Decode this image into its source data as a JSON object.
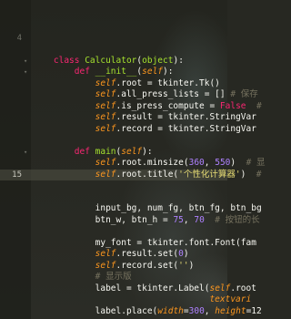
{
  "editor": {
    "lines": [
      {
        "num": "",
        "fold": false,
        "current": false,
        "parts": []
      },
      {
        "num": "",
        "fold": false,
        "current": false,
        "parts": []
      },
      {
        "num": "",
        "fold": false,
        "current": false,
        "parts": []
      },
      {
        "num": "4",
        "fold": false,
        "current": false,
        "parts": []
      },
      {
        "num": "",
        "fold": false,
        "current": false,
        "parts": []
      },
      {
        "num": "",
        "fold": true,
        "current": false,
        "parts": [
          [
            "kw",
            "    class "
          ],
          [
            "cls",
            "Calculator"
          ],
          [
            "name",
            "("
          ],
          [
            "cls",
            "object"
          ],
          [
            "name",
            "):"
          ]
        ]
      },
      {
        "num": "",
        "fold": true,
        "current": false,
        "parts": [
          [
            "kw",
            "        def "
          ],
          [
            "fn",
            "__init__"
          ],
          [
            "name",
            "("
          ],
          [
            "param",
            "self"
          ],
          [
            "name",
            "):"
          ]
        ]
      },
      {
        "num": "",
        "fold": false,
        "current": false,
        "parts": [
          [
            "self",
            "            self"
          ],
          [
            "name",
            ".root = tkinter.Tk()"
          ]
        ]
      },
      {
        "num": "",
        "fold": false,
        "current": false,
        "parts": [
          [
            "self",
            "            self"
          ],
          [
            "name",
            ".all_press_lists = [] "
          ],
          [
            "cm",
            "# 保存"
          ]
        ]
      },
      {
        "num": "",
        "fold": false,
        "current": false,
        "parts": [
          [
            "self",
            "            self"
          ],
          [
            "name",
            ".is_press_compute = "
          ],
          [
            "kw",
            "False"
          ],
          [
            "cm",
            "  #"
          ]
        ]
      },
      {
        "num": "",
        "fold": false,
        "current": false,
        "parts": [
          [
            "self",
            "            self"
          ],
          [
            "name",
            ".result = tkinter.StringVar"
          ]
        ]
      },
      {
        "num": "",
        "fold": false,
        "current": false,
        "parts": [
          [
            "self",
            "            self"
          ],
          [
            "name",
            ".record = tkinter.StringVar"
          ]
        ]
      },
      {
        "num": "",
        "fold": false,
        "current": false,
        "parts": []
      },
      {
        "num": "",
        "fold": true,
        "current": false,
        "parts": [
          [
            "kw",
            "        def "
          ],
          [
            "fn",
            "main"
          ],
          [
            "name",
            "("
          ],
          [
            "param",
            "self"
          ],
          [
            "name",
            "):"
          ]
        ]
      },
      {
        "num": "",
        "fold": false,
        "current": false,
        "parts": [
          [
            "self",
            "            self"
          ],
          [
            "name",
            ".root.minsize("
          ],
          [
            "num",
            "360"
          ],
          [
            "name",
            ", "
          ],
          [
            "num",
            "550"
          ],
          [
            "name",
            ")  "
          ],
          [
            "cm",
            "# 显"
          ]
        ]
      },
      {
        "num": "15",
        "fold": false,
        "current": true,
        "parts": [
          [
            "self",
            "            self"
          ],
          [
            "name",
            ".root.title("
          ],
          [
            "str",
            "'个性化计算器'"
          ],
          [
            "name",
            ")  "
          ],
          [
            "cm",
            "#"
          ]
        ]
      },
      {
        "num": "",
        "fold": false,
        "current": false,
        "parts": []
      },
      {
        "num": "",
        "fold": false,
        "current": false,
        "parts": []
      },
      {
        "num": "",
        "fold": false,
        "current": false,
        "parts": [
          [
            "name",
            "            input_bg, num_fg, btn_fg, btn_bg"
          ]
        ]
      },
      {
        "num": "",
        "fold": false,
        "current": false,
        "parts": [
          [
            "name",
            "            btn_w, btn_h = "
          ],
          [
            "num",
            "75"
          ],
          [
            "name",
            ", "
          ],
          [
            "num",
            "70"
          ],
          [
            "cm",
            "  # 按钮的长"
          ]
        ]
      },
      {
        "num": "",
        "fold": false,
        "current": false,
        "parts": []
      },
      {
        "num": "",
        "fold": false,
        "current": false,
        "parts": [
          [
            "name",
            "            my_font = tkinter.font.Font(fam"
          ]
        ]
      },
      {
        "num": "",
        "fold": false,
        "current": false,
        "parts": [
          [
            "self",
            "            self"
          ],
          [
            "name",
            ".result.set("
          ],
          [
            "num",
            "0"
          ],
          [
            "name",
            ")"
          ]
        ]
      },
      {
        "num": "",
        "fold": false,
        "current": false,
        "parts": [
          [
            "self",
            "            self"
          ],
          [
            "name",
            ".record.set("
          ],
          [
            "str",
            "''"
          ],
          [
            "name",
            ")"
          ]
        ]
      },
      {
        "num": "",
        "fold": false,
        "current": false,
        "parts": [
          [
            "cm",
            "            # 显示版"
          ]
        ]
      },
      {
        "num": "",
        "fold": false,
        "current": false,
        "parts": [
          [
            "name",
            "            label = tkinter.Label("
          ],
          [
            "self",
            "self"
          ],
          [
            "name",
            ".root"
          ]
        ]
      },
      {
        "num": "",
        "fold": false,
        "current": false,
        "parts": [
          [
            "param",
            "                                  textvari"
          ]
        ]
      },
      {
        "num": "",
        "fold": false,
        "current": false,
        "parts": [
          [
            "name",
            "            label.place("
          ],
          [
            "param",
            "width"
          ],
          [
            "name",
            "="
          ],
          [
            "num",
            "300"
          ],
          [
            "name",
            ", "
          ],
          [
            "param",
            "height"
          ],
          [
            "name",
            "=12"
          ]
        ]
      }
    ]
  }
}
